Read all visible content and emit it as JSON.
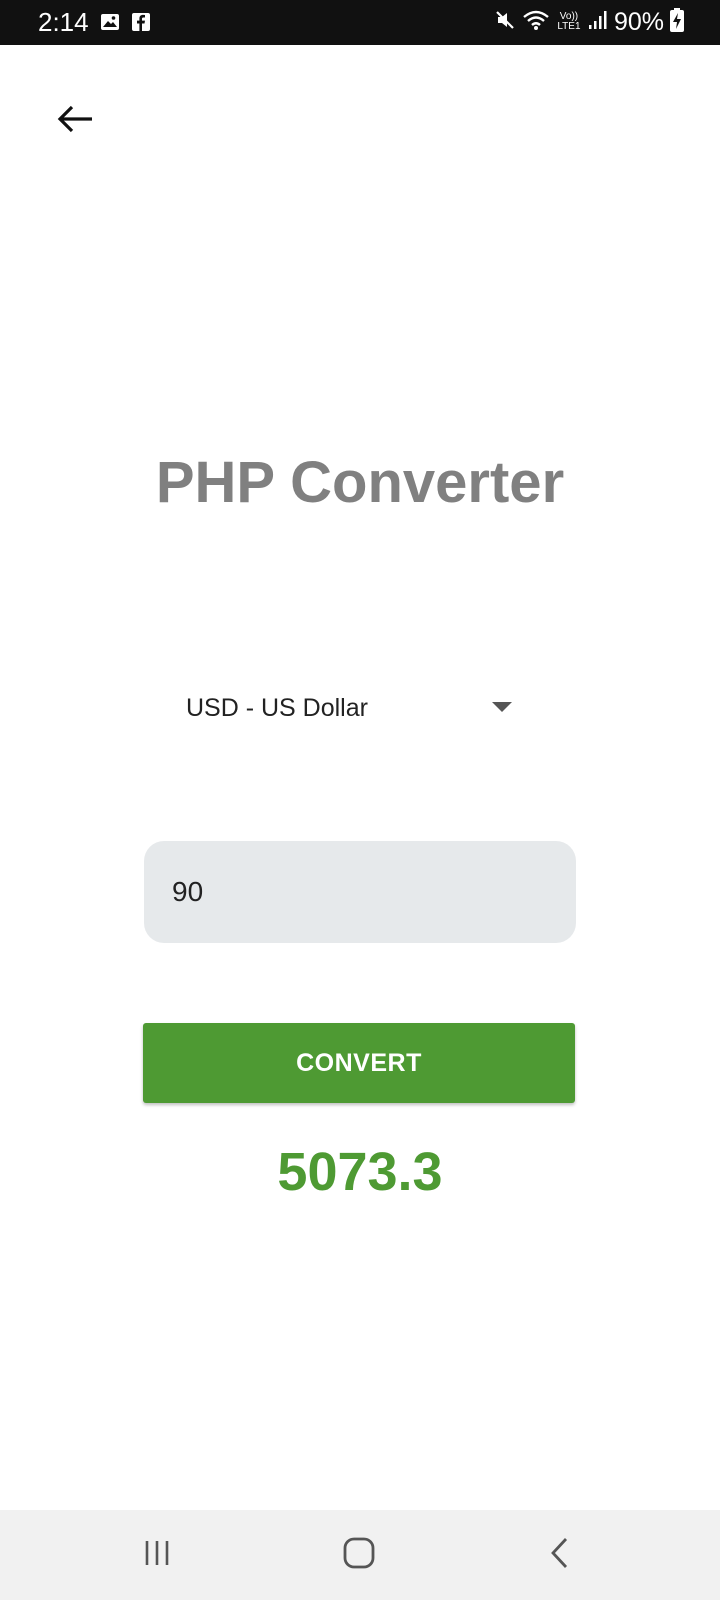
{
  "status_bar": {
    "time": "2:14",
    "lte_top": "Vo))",
    "lte_bottom": "LTE1",
    "battery": "90%",
    "icons": [
      "gallery-icon",
      "facebook-icon",
      "mute-icon",
      "wifi-icon",
      "signal-icon",
      "battery-charging-icon"
    ]
  },
  "header": {
    "back_icon": "arrow-left-icon"
  },
  "title": "PHP Converter",
  "currency_select": {
    "selected": "USD - US Dollar"
  },
  "amount_input": {
    "value": "90"
  },
  "convert_button": {
    "label": "CONVERT"
  },
  "result": "5073.3",
  "colors": {
    "accent_green": "#4e9a33",
    "title_gray": "#808080",
    "input_bg": "#e6e9eb",
    "status_bar_bg": "#111111"
  },
  "nav_bar": {
    "icons": [
      "recent-apps-icon",
      "home-icon",
      "back-nav-icon"
    ]
  }
}
